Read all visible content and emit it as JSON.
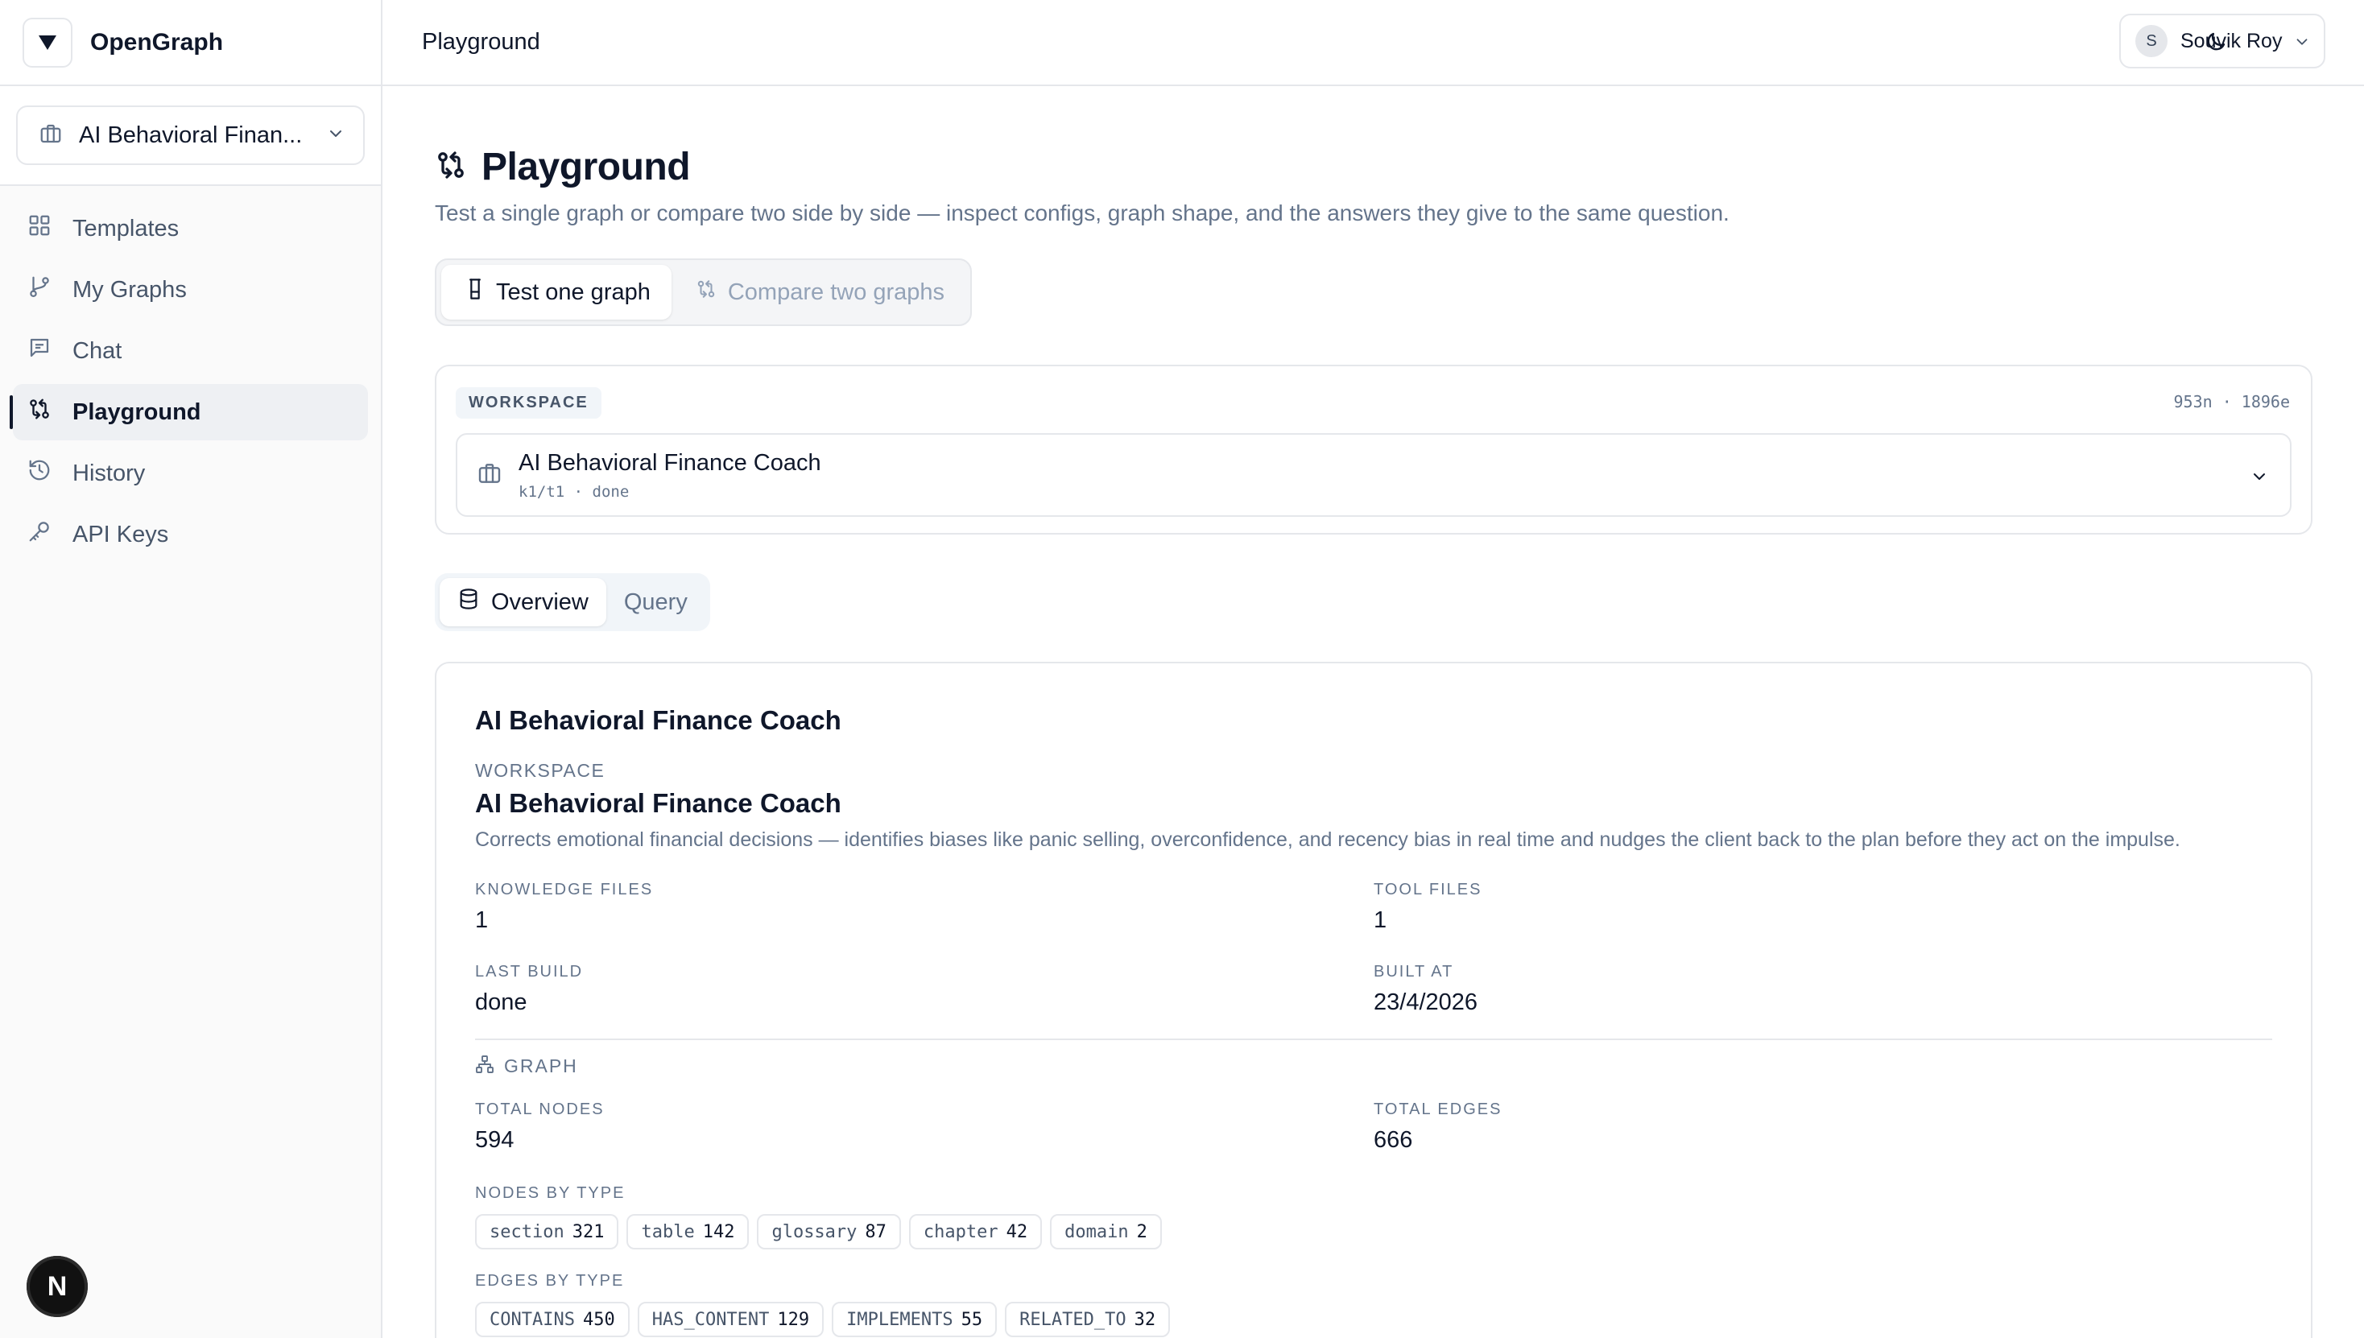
{
  "app": {
    "name": "OpenGraph"
  },
  "sidebar": {
    "workspace_selector": "AI Behavioral Finan...",
    "items": [
      {
        "label": "Templates",
        "icon": "grid-icon"
      },
      {
        "label": "My Graphs",
        "icon": "git-branch-icon"
      },
      {
        "label": "Chat",
        "icon": "message-square-icon"
      },
      {
        "label": "Playground",
        "icon": "git-compare-icon",
        "active": true
      },
      {
        "label": "History",
        "icon": "history-icon"
      },
      {
        "label": "API Keys",
        "icon": "key-icon"
      }
    ],
    "dev_badge": "N"
  },
  "topbar": {
    "title": "Playground",
    "user": {
      "initial": "S",
      "name": "Souvik Roy"
    }
  },
  "page": {
    "title": "Playground",
    "subtitle": "Test a single graph or compare two side by side — inspect configs, graph shape, and the answers they give to the same question."
  },
  "mode_tabs": {
    "test_one": "Test one graph",
    "compare_two": "Compare two graphs",
    "active": "test_one"
  },
  "workspace_card": {
    "tag": "WORKSPACE",
    "counts": "953n · 1896e",
    "selected_name": "AI Behavioral Finance Coach",
    "selected_meta": "k1/t1 · done"
  },
  "view_tabs": {
    "overview": "Overview",
    "query": "Query",
    "active": "overview"
  },
  "overview": {
    "title": "AI Behavioral Finance Coach",
    "workspace_label": "WORKSPACE",
    "workspace_name": "AI Behavioral Finance Coach",
    "description": "Corrects emotional financial decisions — identifies biases like panic selling, overconfidence, and recency bias in real time and nudges the client back to the plan before they act on the impulse.",
    "knowledge_files_label": "KNOWLEDGE FILES",
    "knowledge_files": "1",
    "tool_files_label": "TOOL FILES",
    "tool_files": "1",
    "last_build_label": "LAST BUILD",
    "last_build": "done",
    "built_at_label": "BUILT AT",
    "built_at": "23/4/2026",
    "graph_label": "GRAPH",
    "total_nodes_label": "TOTAL NODES",
    "total_nodes": "594",
    "total_edges_label": "TOTAL EDGES",
    "total_edges": "666",
    "nodes_by_type_label": "NODES BY TYPE",
    "nodes_by_type": [
      {
        "type": "section",
        "count": "321"
      },
      {
        "type": "table",
        "count": "142"
      },
      {
        "type": "glossary",
        "count": "87"
      },
      {
        "type": "chapter",
        "count": "42"
      },
      {
        "type": "domain",
        "count": "2"
      }
    ],
    "edges_by_type_label": "EDGES BY TYPE",
    "edges_by_type": [
      {
        "type": "CONTAINS",
        "count": "450"
      },
      {
        "type": "HAS_CONTENT",
        "count": "129"
      },
      {
        "type": "IMPLEMENTS",
        "count": "55"
      },
      {
        "type": "RELATED_TO",
        "count": "32"
      }
    ]
  }
}
